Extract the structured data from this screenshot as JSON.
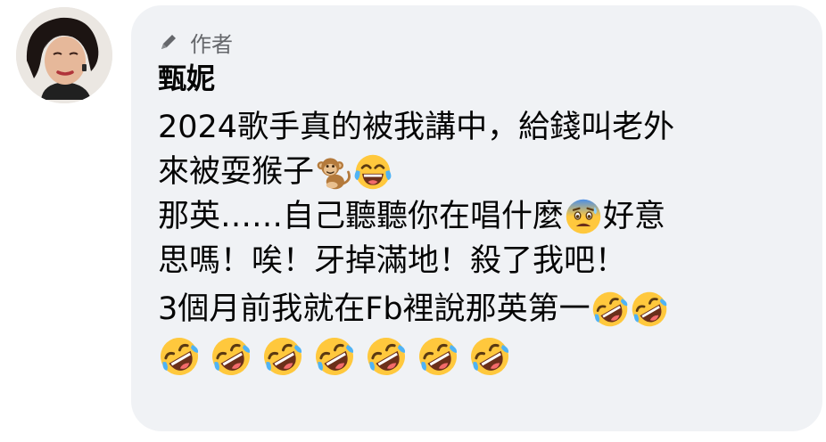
{
  "comment": {
    "badge_label": "作者",
    "badge_icon": "pen-icon",
    "author_name": "甄妮",
    "paragraphs": [
      [
        "2024歌手真的被我講中，給錢叫老外",
        "來被耍猴子"
      ],
      [
        "那英……自己聽聽你在唱什麼",
        "好意",
        "思嗎！唉！牙掉滿地！殺了我吧！"
      ],
      [
        "3個月前我就在Fb裡說那英第一"
      ]
    ],
    "emojis": {
      "monkey": "monkey-emoji",
      "tears_of_joy": "face-with-tears-of-joy-emoji",
      "anxious": "anxious-face-emoji",
      "rofl": "rolling-on-floor-laughing-emoji"
    }
  },
  "colors": {
    "bubble_bg": "#f0f2f5",
    "text": "#050505",
    "meta_text": "#65676b"
  }
}
